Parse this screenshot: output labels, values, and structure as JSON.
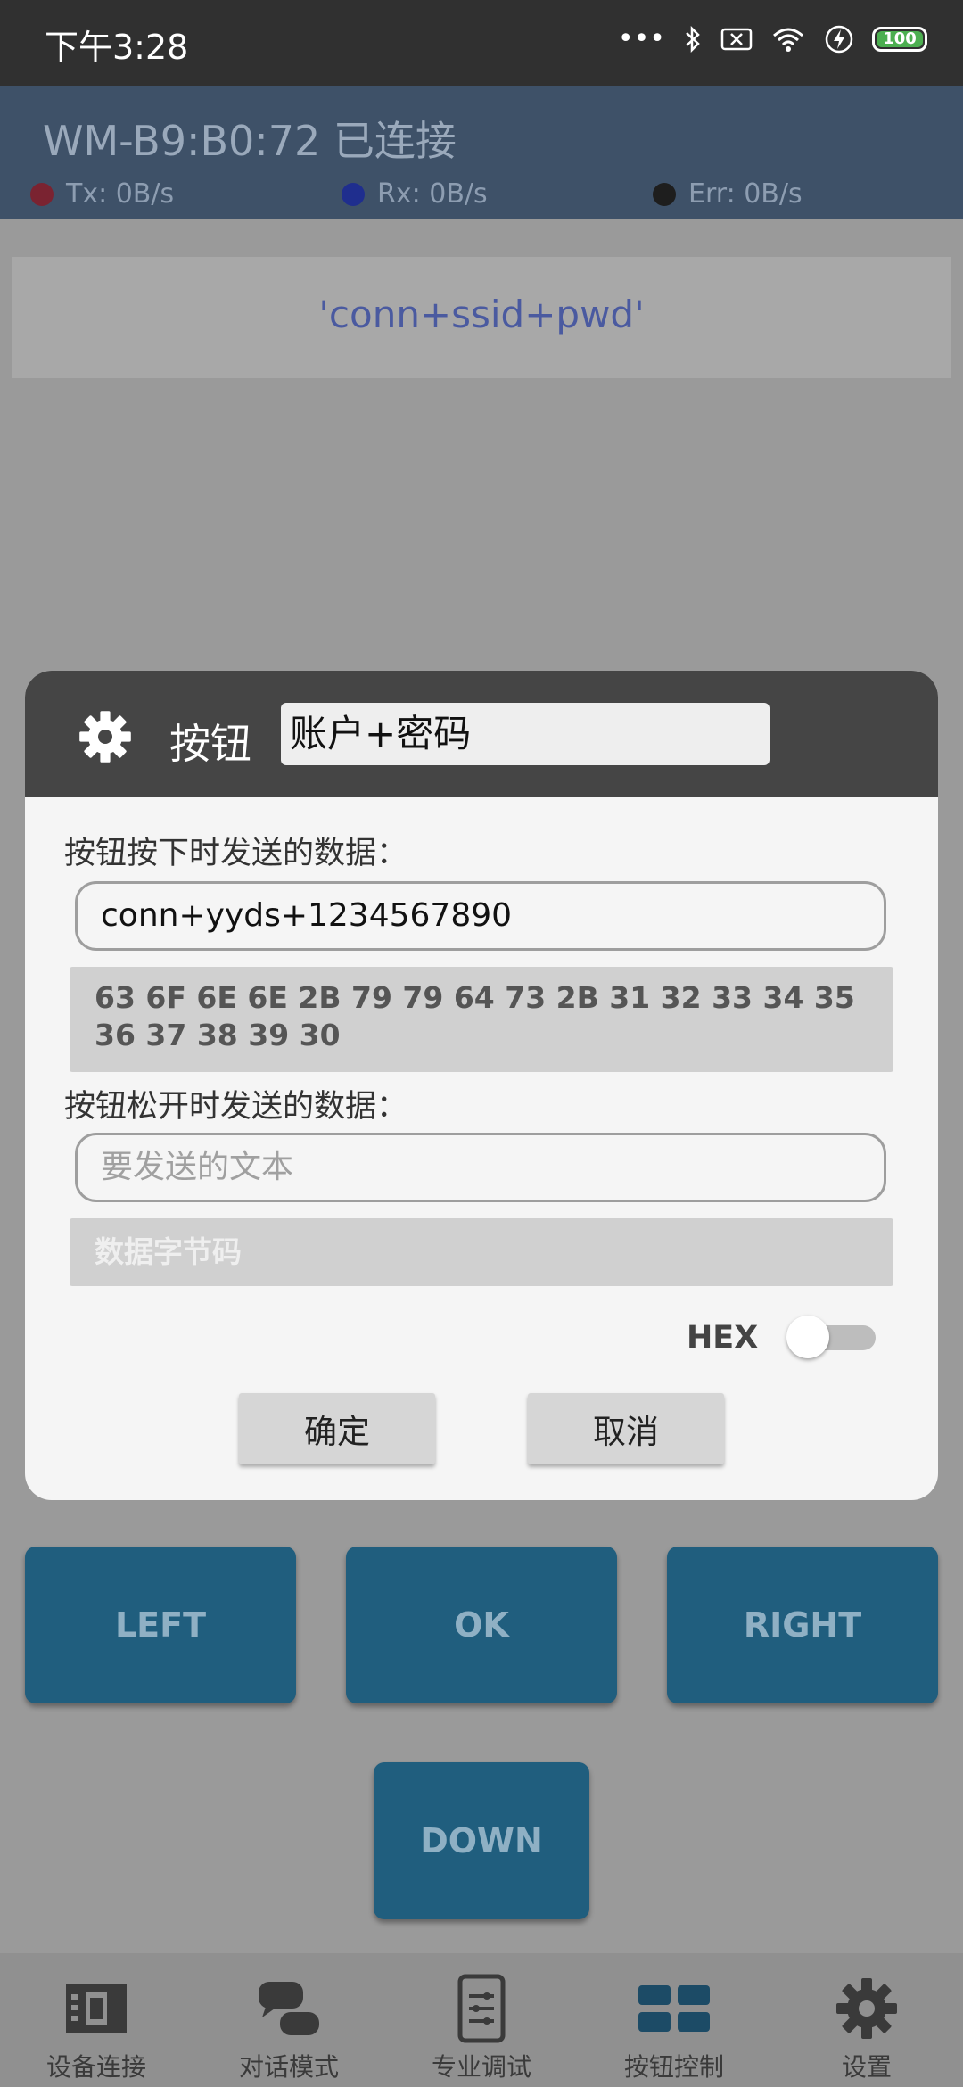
{
  "status_bar": {
    "time": "下午3:28",
    "battery_level": "100",
    "icons": [
      "more-dots-icon",
      "bluetooth-icon",
      "no-sim-icon",
      "wifi-icon",
      "charging-icon",
      "battery-icon"
    ]
  },
  "header": {
    "device_title": "WM-B9:B0:72 已连接",
    "tx": "Tx: 0B/s",
    "rx": "Rx: 0B/s",
    "err": "Err: 0B/s",
    "colors": {
      "tx_dot": "#7a2331",
      "rx_dot": "#1f2e8e",
      "err_dot": "#1e1e1e"
    }
  },
  "command_display": "'conn+ssid+pwd'",
  "buttons": {
    "left": "LEFT",
    "ok": "OK",
    "right": "RIGHT",
    "down": "DOWN"
  },
  "bottom_nav": [
    {
      "label": "设备连接",
      "icon": "device-connect-icon"
    },
    {
      "label": "对话模式",
      "icon": "chat-icon"
    },
    {
      "label": "专业调试",
      "icon": "debug-panel-icon"
    },
    {
      "label": "按钮控制",
      "icon": "button-grid-icon"
    },
    {
      "label": "设置",
      "icon": "gear-icon"
    }
  ],
  "dialog": {
    "title_label": "按钮",
    "button_name": "账户+密码",
    "press_label": "按钮按下时发送的数据：",
    "press_text": "conn+yyds+1234567890",
    "press_hex": "63 6F 6E 6E 2B 79 79 64 73 2B 31 32 33 34 35 36 37 38 39 30",
    "release_label": "按钮松开时发送的数据：",
    "release_placeholder": "要发送的文本",
    "release_hex_placeholder": "数据字节码",
    "hex_label": "HEX",
    "hex_enabled": false,
    "confirm": "确定",
    "cancel": "取消"
  }
}
